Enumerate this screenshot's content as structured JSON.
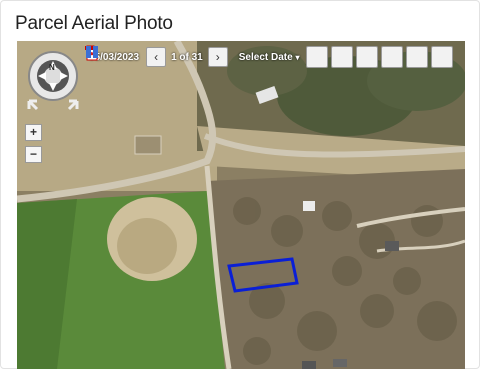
{
  "card": {
    "title": "Parcel Aerial Photo"
  },
  "toolbar": {
    "date": "05/03/2023",
    "prev_label": "‹",
    "next_label": "›",
    "pager": "1 of 31",
    "select_label": "Select Date",
    "select_caret": "▾"
  },
  "zoom": {
    "in_label": "+",
    "out_label": "−"
  },
  "compass": {
    "north_label": "N"
  },
  "colors": {
    "parcel_outline": "#0a1fd6",
    "road": "#cfc7b4"
  }
}
